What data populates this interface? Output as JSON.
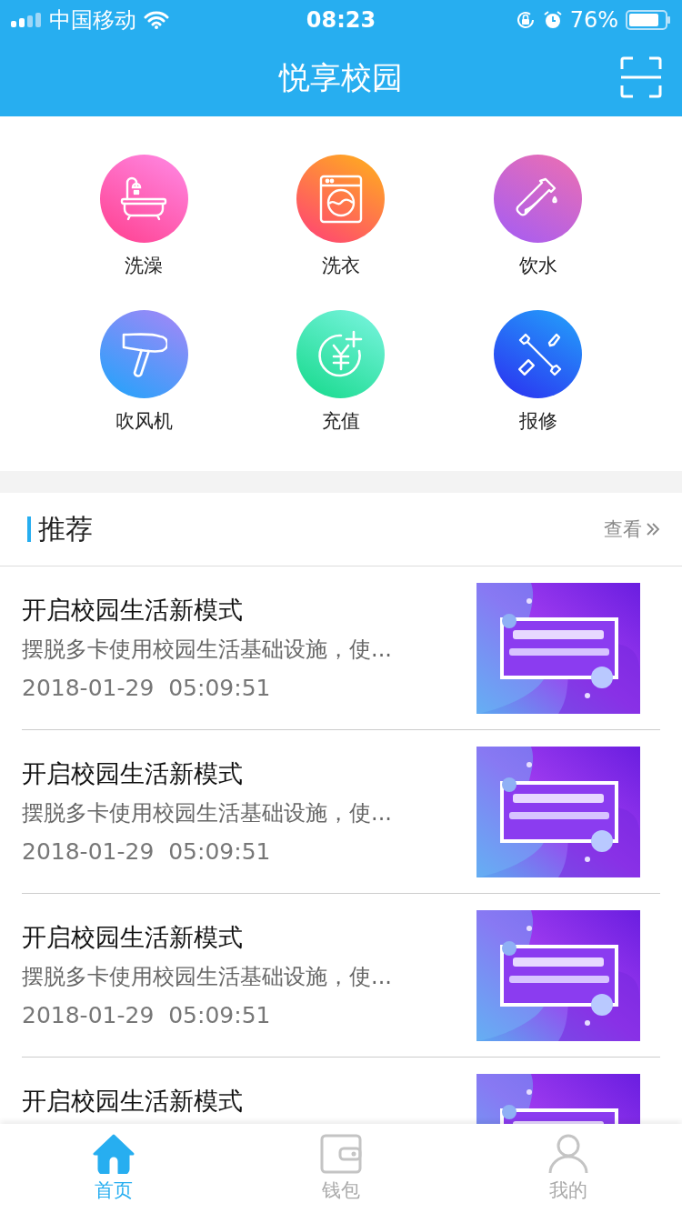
{
  "status_bar": {
    "carrier": "中国移动",
    "time": "08:23",
    "battery": "76%"
  },
  "nav": {
    "title": "悦享校园"
  },
  "services": [
    {
      "kind": "bath",
      "label": "洗澡"
    },
    {
      "kind": "laundry",
      "label": "洗衣"
    },
    {
      "kind": "water",
      "label": "饮水"
    },
    {
      "kind": "dryer",
      "label": "吹风机"
    },
    {
      "kind": "recharge",
      "label": "充值"
    },
    {
      "kind": "repair",
      "label": "报修"
    }
  ],
  "recommend": {
    "title": "推荐",
    "more": "查看"
  },
  "articles": [
    {
      "title": "开启校园生活新模式",
      "summary": "摆脱多卡使用校园生活基础设施，使...",
      "date": "2018-01-29  05:09:51",
      "kind": "picture"
    },
    {
      "title": "开启校园生活新模式",
      "summary": "摆脱多卡使用校园生活基础设施，使...",
      "date": "2018-01-29  05:09:51",
      "kind": "picture"
    },
    {
      "title": "开启校园生活新模式",
      "summary": "摆脱多卡使用校园生活基础设施，使...",
      "date": "2018-01-29  05:09:51",
      "kind": "picture"
    },
    {
      "title": "开启校园生活新模式",
      "kind": "picture"
    }
  ],
  "tabs": [
    {
      "kind": "home",
      "label": "首页",
      "selected": true
    },
    {
      "kind": "wallet",
      "label": "钱包",
      "selected": false
    },
    {
      "kind": "profile",
      "label": "我的",
      "selected": false
    }
  ]
}
